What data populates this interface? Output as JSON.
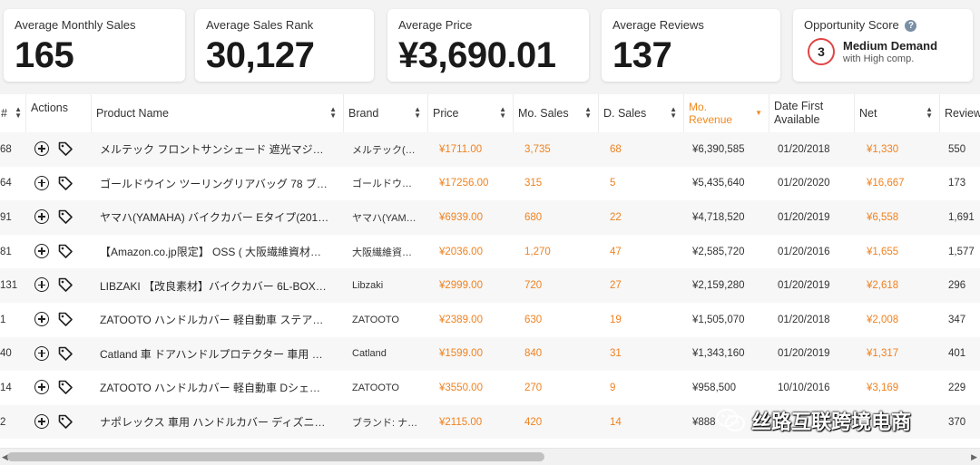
{
  "stats": {
    "monthly_sales": {
      "label": "Average Monthly Sales",
      "value": "165"
    },
    "sales_rank": {
      "label": "Average Sales Rank",
      "value": "30,127"
    },
    "price": {
      "label": "Average Price",
      "value": "¥3,690.01"
    },
    "reviews": {
      "label": "Average Reviews",
      "value": "137"
    },
    "opportunity": {
      "label": "Opportunity Score",
      "help_icon": "?",
      "score": "3",
      "title": "Medium Demand",
      "subtitle": "with High comp."
    }
  },
  "table": {
    "columns": {
      "rank": "#",
      "actions": "Actions",
      "name": "Product Name",
      "brand": "Brand",
      "price": "Price",
      "mo_sales": "Mo. Sales",
      "d_sales": "D. Sales",
      "mo_revenue": "Mo. Revenue",
      "date_first": "Date First Available",
      "net": "Net",
      "reviews": "Review"
    },
    "rows": [
      {
        "rank": "68",
        "name": "メルテック フロントサンシェード 遮光マジ…",
        "brand": "メルテック(…",
        "price": "¥1711.00",
        "mo_sales": "3,735",
        "d_sales": "68",
        "mo_revenue": "¥6,390,585",
        "date": "01/20/2018",
        "net": "¥1,330",
        "reviews": "550"
      },
      {
        "rank": "64",
        "name": "ゴールドウイン ツーリングリアバッグ 78 ブ…",
        "brand": "ゴールドウ…",
        "price": "¥17256.00",
        "mo_sales": "315",
        "d_sales": "5",
        "mo_revenue": "¥5,435,640",
        "date": "01/20/2020",
        "net": "¥16,667",
        "reviews": "173"
      },
      {
        "rank": "91",
        "name": "ヤマハ(YAMAHA) バイクカバー Eタイプ(201…",
        "brand": "ヤマハ(YAM…",
        "price": "¥6939.00",
        "mo_sales": "680",
        "d_sales": "22",
        "mo_revenue": "¥4,718,520",
        "date": "01/20/2019",
        "net": "¥6,558",
        "reviews": "1,691"
      },
      {
        "rank": "81",
        "name": "【Amazon.co.jp限定】 OSS ( 大阪繊維資材…",
        "brand": "大阪繊維資…",
        "price": "¥2036.00",
        "mo_sales": "1,270",
        "d_sales": "47",
        "mo_revenue": "¥2,585,720",
        "date": "01/20/2016",
        "net": "¥1,655",
        "reviews": "1,577"
      },
      {
        "rank": "131",
        "name": "LIBZAKI 【改良素材】バイクカバー 6L-BOX…",
        "brand": "Libzaki",
        "price": "¥2999.00",
        "mo_sales": "720",
        "d_sales": "27",
        "mo_revenue": "¥2,159,280",
        "date": "01/20/2019",
        "net": "¥2,618",
        "reviews": "296"
      },
      {
        "rank": "1",
        "name": "ZATOOTO ハンドルカバー 軽自動車 ステア…",
        "brand": "ZATOOTO",
        "price": "¥2389.00",
        "mo_sales": "630",
        "d_sales": "19",
        "mo_revenue": "¥1,505,070",
        "date": "01/20/2018",
        "net": "¥2,008",
        "reviews": "347"
      },
      {
        "rank": "40",
        "name": "Catland 車 ドアハンドルプロテクター 車用 …",
        "brand": "Catland",
        "price": "¥1599.00",
        "mo_sales": "840",
        "d_sales": "31",
        "mo_revenue": "¥1,343,160",
        "date": "01/20/2019",
        "net": "¥1,317",
        "reviews": "401"
      },
      {
        "rank": "14",
        "name": "ZATOOTO ハンドルカバー 軽自動車 Dシェ…",
        "brand": "ZATOOTO",
        "price": "¥3550.00",
        "mo_sales": "270",
        "d_sales": "9",
        "mo_revenue": "¥958,500",
        "date": "10/10/2016",
        "net": "¥3,169",
        "reviews": "229"
      },
      {
        "rank": "2",
        "name": "ナポレックス 車用 ハンドルカバー ディズニ…",
        "brand": "ブランド: ナ…",
        "price": "¥2115.00",
        "mo_sales": "420",
        "d_sales": "14",
        "mo_revenue": "¥888",
        "date": "",
        "net": "",
        "reviews": "370"
      }
    ]
  },
  "watermark": {
    "text": "丝路互联跨境电商",
    "icon": "wechat-icon"
  },
  "colors": {
    "accent": "#f08220",
    "score_ring": "#e04545"
  }
}
